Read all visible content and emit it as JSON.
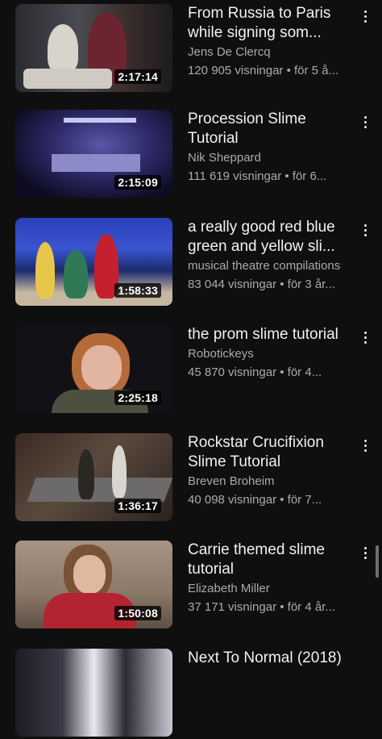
{
  "videos": [
    {
      "title": "From Russia to Paris while signing som...",
      "channel": "Jens De Clercq",
      "stats": "120 905 visningar • för 5 å...",
      "duration": "2:17:14"
    },
    {
      "title": "Procession Slime Tutorial",
      "channel": "Nik Sheppard",
      "stats": "111 619 visningar • för 6...",
      "duration": "2:15:09"
    },
    {
      "title": "a really good red blue green and yellow sli...",
      "channel": "musical theatre compilations",
      "stats": "83 044 visningar • för 3 år...",
      "duration": "1:58:33"
    },
    {
      "title": "the prom slime tutorial",
      "channel": "Robotickeys",
      "stats": "45 870 visningar • för 4...",
      "duration": "2:25:18"
    },
    {
      "title": "Rockstar Crucifixion Slime Tutorial",
      "channel": "Breven Broheim",
      "stats": "40 098 visningar • för 7...",
      "duration": "1:36:17"
    },
    {
      "title": "Carrie themed slime tutorial",
      "channel": "Elizabeth Miller",
      "stats": "37 171 visningar • för 4 år...",
      "duration": "1:50:08"
    },
    {
      "title": "Next To Normal (2018)",
      "channel": "",
      "stats": "",
      "duration": ""
    }
  ],
  "icons": {
    "more": "more-vert-icon"
  }
}
